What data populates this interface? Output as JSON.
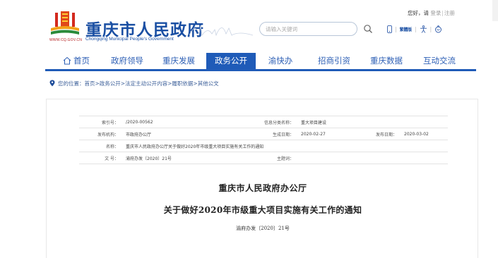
{
  "header": {
    "title": "重庆市人民政府",
    "subtitle": "Chongqing Municipal People's Government",
    "logo_url": "WWW.CQ.GOV.CN",
    "search_placeholder": "请输入关键词",
    "greeting": "您好，请",
    "login": "登录",
    "register": "注册",
    "simplified_traditional": "繁體版",
    "brand_color": "#1f5bb8"
  },
  "nav": {
    "items": [
      {
        "label": "首页",
        "active": false
      },
      {
        "label": "政府领导",
        "active": false
      },
      {
        "label": "重庆发展",
        "active": false
      },
      {
        "label": "政务公开",
        "active": true
      },
      {
        "label": "渝快办",
        "active": false
      },
      {
        "label": "招商引资",
        "active": false
      },
      {
        "label": "重庆数据",
        "active": false
      },
      {
        "label": "互动交流",
        "active": false
      }
    ]
  },
  "breadcrumb": {
    "label": "您的位置：",
    "items": [
      "首页",
      "政务公开",
      "法定主动公开内容",
      "履职依据",
      "其他公文"
    ],
    "separator": " > "
  },
  "document": {
    "meta": {
      "index_label": "索引号：",
      "index_value": "/2020-00562",
      "category_label": "信息分类名称：",
      "category_value": "重大项目建设",
      "issuer_label": "发布机构：",
      "issuer_value": "市政府办公厅",
      "effective_label": "生成日期：",
      "effective_value": "2020-02-27",
      "publish_label": "发布日期：",
      "publish_value": "2020-03-02",
      "name_label": "名称：",
      "name_value": "重庆市人民政府办公厅关于做好2020年市级重大项目实施有关工作的通知",
      "docno_label": "文 号：",
      "docno_value": "渝府办发〔2020〕21号",
      "topic_label": "主题词：",
      "topic_value": ""
    },
    "org": "重庆市人民政府办公厅",
    "title": "关于做好2020年市级重大项目实施有关工作的通知",
    "number": "渝府办发〔2020〕21号"
  },
  "icons": {
    "search": "search-icon",
    "mobile": "mobile-icon",
    "accessibility": "accessibility-icon",
    "elder": "elder-mode-icon",
    "home": "home-icon",
    "location": "location-pin-icon"
  }
}
